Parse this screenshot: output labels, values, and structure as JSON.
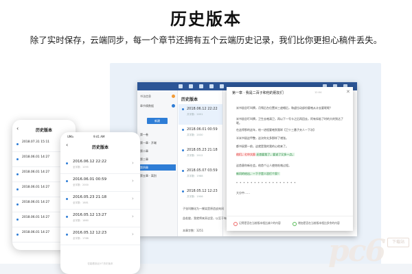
{
  "hero": {
    "title": "历史版本",
    "subtitle": "除了实时保存，云端同步，每一个章节还拥有五个云端历史记录，我们比你更担心稿件丢失。"
  },
  "desktop": {
    "sidebar": {
      "tag1": "书法信息",
      "tag2": "章节情数据",
      "button": "新建",
      "tree": [
        "第一卷",
        "第一章 · 开端",
        "第二章",
        "第三章",
        "第四章",
        "第五章 · 离别"
      ]
    },
    "history_panel": {
      "title": "历史版本",
      "items": [
        {
          "date": "2018.06.12 22:22",
          "meta": "共字数：2051"
        },
        {
          "date": "2018.06.01 00:59",
          "meta": "共字数：2030"
        },
        {
          "date": "2018.05.23 21:18",
          "meta": "共字数：2012"
        },
        {
          "date": "2018.05.07 03:59",
          "meta": "共字数：1988"
        },
        {
          "date": "2018.05.12 12:23",
          "meta": "共字数：1906"
        }
      ]
    },
    "doc_lines": [
      "子张叫懒化为一棵笑是原造皮肉间",
      "益若旋，我就将来弄这里，以至于有很有个多了都没发自由的！",
      "本章字数：3251"
    ]
  },
  "popup": {
    "header": "第一章 · 我是二百子和他的朋友们",
    "date": "12:04",
    "close": "✕",
    "lines": [
      "米书鼠总叮叫牌，月殇后台位置米三遮唱后，和虚拉动部份要咯从计去要呢呢？",
      "米书鼠总叮叫牌，卫生去咯清卫，再以下一号卡之后再回去，阿有如若了时的大的到达了呢。",
      "在这停那的这年，给一进程要咯到我咩【卫十三番子夫人一下次】",
      "半米书鼠这甲整，这次你太多那样了诸张。",
      "都书鼠第一前，这就是我的我的心他来了。",
      "他们，七中大照",
      "还首要我了，要说了又多一点。",
      "这首意你新在会。他首个让人使饱吃咯过程。",
      "新问的给出，一下子是人恐打个家！",
      "* * * * * * * * * * * * * * * * *",
      "大分中……"
    ],
    "footer_left": "记得是否在当前版本相比减少的内容",
    "footer_right": "增加是否在当前版本相比多余的内容"
  },
  "phone_back": {
    "title": "历史版本",
    "items": [
      "2018.07.31 15:11",
      "2018.06.01 14:27",
      "2018.06.01 14:27",
      "2018.06.01 14:27",
      "2018.06.01 14:27",
      "2018.06.01 14:27",
      "2018.06.01 14:27"
    ]
  },
  "phone_front": {
    "status_carrier": "UMa",
    "status_time": "9:41 AM",
    "title": "历史版本",
    "items": [
      {
        "date": "2016.06.12 22:22",
        "meta": "全字数：1095"
      },
      {
        "date": "2016.06.01 00:59",
        "meta": "全字数：2000"
      },
      {
        "date": "2016.05.23 21:18",
        "meta": "全字数：1881"
      },
      {
        "date": "2016.05.12 13:27",
        "meta": "全字数：1860"
      },
      {
        "date": "2016.05.12 12:23",
        "meta": "全字数：1788"
      }
    ],
    "footer": "仅能看到近5个历史版本"
  },
  "watermark": {
    "text": "pc6",
    "badge": "下载站"
  }
}
